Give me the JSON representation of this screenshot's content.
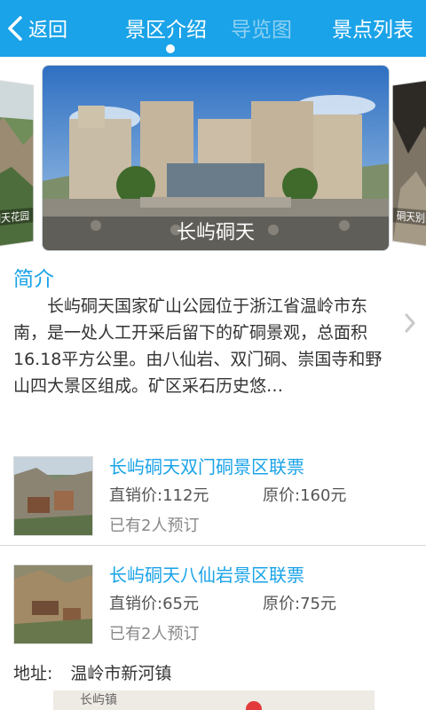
{
  "header": {
    "back_label": "返回",
    "tabs": [
      {
        "label": "景区介绍",
        "active": true
      },
      {
        "label": "导览图",
        "active": false
      },
      {
        "label": "景点列表",
        "active": false
      }
    ],
    "bg_color": "#1aa3e8"
  },
  "carousel": {
    "main_caption": "长屿硐天",
    "left_caption": "硐天花园",
    "right_caption": "硐天别院"
  },
  "intro": {
    "title": "简介",
    "body": "长屿硐天国家矿山公园位于浙江省温岭市东南，是一处人工开采后留下的矿硐景观，总面积16.18平方公里。由八仙岩、双门硐、崇国寺和野山四大景区组成。矿区采石历史悠…"
  },
  "tickets": [
    {
      "title": "长屿硐天双门硐景区联票",
      "price_label": "直销价:",
      "price": "112元",
      "orig_label": "原价:",
      "orig_price": "160元",
      "booked": "已有2人预订"
    },
    {
      "title": "长屿硐天八仙岩景区联票",
      "price_label": "直销价:",
      "price": "65元",
      "orig_label": "原价:",
      "orig_price": "75元",
      "booked": "已有2人预订"
    }
  ],
  "address": {
    "label": "地址:",
    "value": "温岭市新河镇"
  },
  "map": {
    "label": "长屿镇"
  }
}
